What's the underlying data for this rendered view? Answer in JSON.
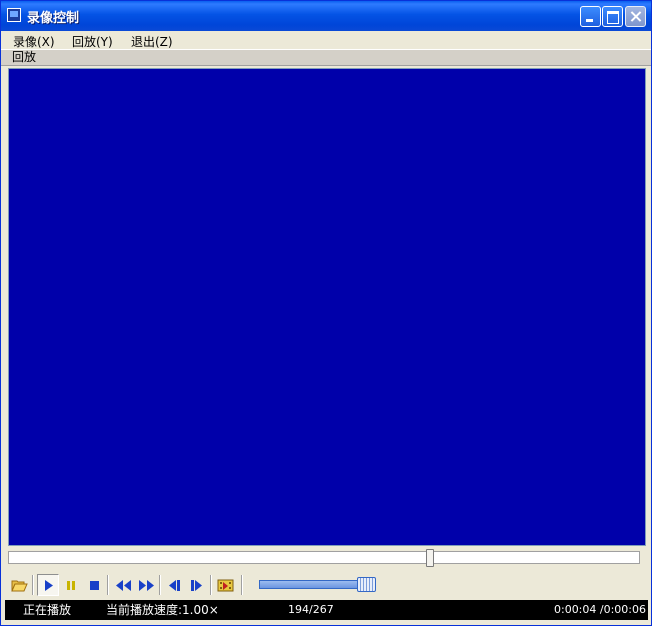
{
  "window": {
    "title": "录像控制"
  },
  "menu": [
    {
      "label": "录像(X)"
    },
    {
      "label": "回放(Y)"
    },
    {
      "label": "退出(Z)"
    }
  ],
  "section_label": "回放",
  "video": {
    "background_color": "#0000AA"
  },
  "seek": {
    "fraction": 0.67
  },
  "toolbar": {
    "icons": [
      "open-folder-icon",
      "play-icon",
      "pause-icon",
      "stop-icon",
      "rewind-icon",
      "fast-forward-icon",
      "step-back-icon",
      "step-forward-icon",
      "snapshot-film-icon"
    ]
  },
  "volume": {
    "fraction": 0.85
  },
  "status": {
    "state": "正在播放",
    "speed": "当前播放速度:1.00×",
    "frames": "194/267",
    "time": "0:00:04 /0:00:06"
  }
}
